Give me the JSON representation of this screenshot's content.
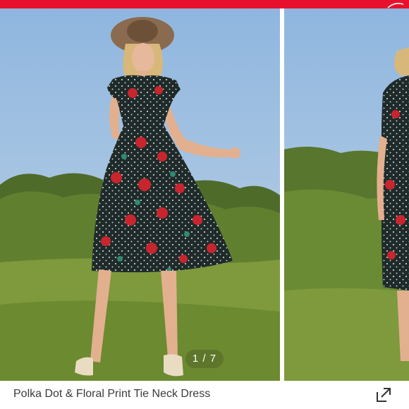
{
  "header": {
    "accent_color": "#e8112d"
  },
  "gallery": {
    "counter": "1 / 7",
    "images": [
      {
        "name": "product-photo-main",
        "description": "woman in polka dot floral dress outdoors"
      },
      {
        "name": "product-photo-next",
        "description": "side view of same dress"
      }
    ]
  },
  "product": {
    "title": "Polka Dot & Floral Print Tie Neck Dress"
  },
  "actions": {
    "share_icon": "share-external-icon"
  }
}
